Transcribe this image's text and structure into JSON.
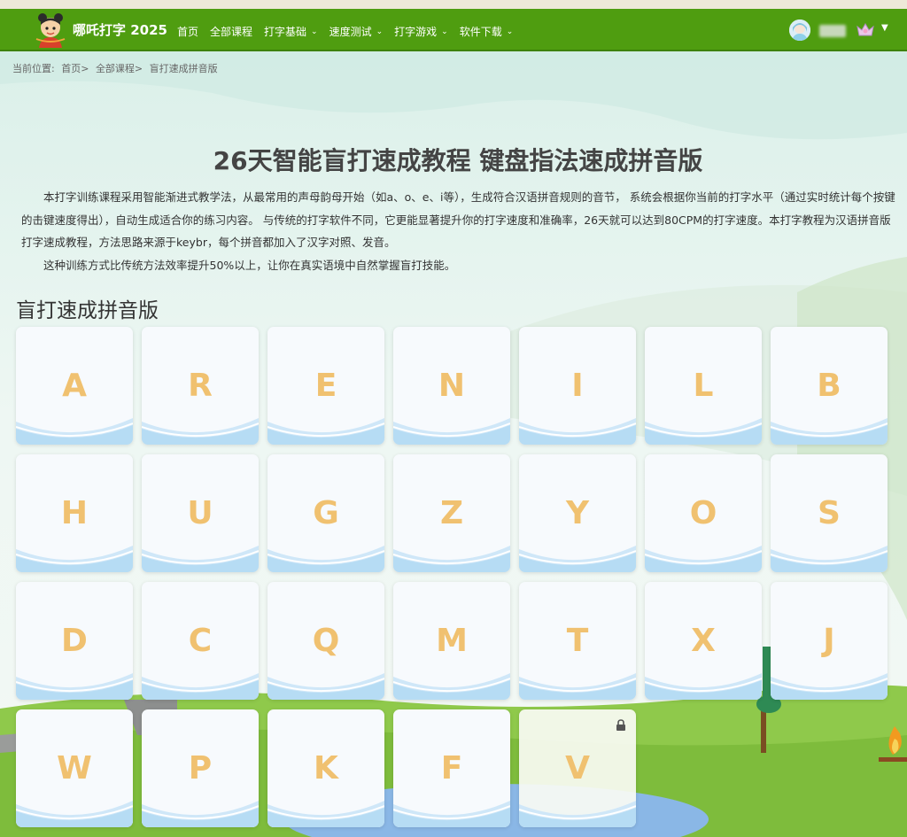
{
  "brand": {
    "name": "哪吒打字 2025"
  },
  "nav": [
    {
      "label": "首页",
      "dropdown": false
    },
    {
      "label": "全部课程",
      "dropdown": false
    },
    {
      "label": "打字基础",
      "dropdown": true
    },
    {
      "label": "速度测试",
      "dropdown": true
    },
    {
      "label": "打字游戏",
      "dropdown": true
    },
    {
      "label": "软件下载",
      "dropdown": true
    }
  ],
  "user": {
    "menu_icon": "chevron-down-icon"
  },
  "breadcrumb": {
    "prefix": "当前位置:",
    "home": "首页>",
    "courses": "全部课程>",
    "current": "盲打速成拼音版"
  },
  "page": {
    "title": "26天智能盲打速成教程 键盘指法速成拼音版",
    "intro_p1": "本打字训练课程采用智能渐进式教学法，从最常用的声母韵母开始（如a、o、e、i等），生成符合汉语拼音规则的音节， 系统会根据你当前的打字水平（通过实时统计每个按键的击键速度得出），自动生成适合你的练习内容。 与传统的打字软件不同，它更能显著提升你的打字速度和准确率，26天就可以达到80CPM的打字速度。本打字教程为汉语拼音版打字速成教程，方法思路来源于keybr，每个拼音都加入了汉字对照、发音。",
    "intro_p2": "这种训练方式比传统方法效率提升50%以上，让你在真实语境中自然掌握盲打技能。",
    "section_title": "盲打速成拼音版"
  },
  "lessons": [
    {
      "letter": "A",
      "locked": false
    },
    {
      "letter": "R",
      "locked": false
    },
    {
      "letter": "E",
      "locked": false
    },
    {
      "letter": "N",
      "locked": false
    },
    {
      "letter": "I",
      "locked": false
    },
    {
      "letter": "L",
      "locked": false
    },
    {
      "letter": "B",
      "locked": false
    },
    {
      "letter": "H",
      "locked": false
    },
    {
      "letter": "U",
      "locked": false
    },
    {
      "letter": "G",
      "locked": false
    },
    {
      "letter": "Z",
      "locked": false
    },
    {
      "letter": "Y",
      "locked": false
    },
    {
      "letter": "O",
      "locked": false
    },
    {
      "letter": "S",
      "locked": false
    },
    {
      "letter": "D",
      "locked": false
    },
    {
      "letter": "C",
      "locked": false
    },
    {
      "letter": "Q",
      "locked": false
    },
    {
      "letter": "M",
      "locked": false
    },
    {
      "letter": "T",
      "locked": false
    },
    {
      "letter": "X",
      "locked": false
    },
    {
      "letter": "J",
      "locked": false
    },
    {
      "letter": "W",
      "locked": false
    },
    {
      "letter": "P",
      "locked": false
    },
    {
      "letter": "K",
      "locked": false
    },
    {
      "letter": "F",
      "locked": false
    },
    {
      "letter": "V",
      "locked": true
    }
  ],
  "colors": {
    "nav_bg": "#4f9d10",
    "letter": "#f0c170",
    "wave": "#b6dcf4"
  }
}
